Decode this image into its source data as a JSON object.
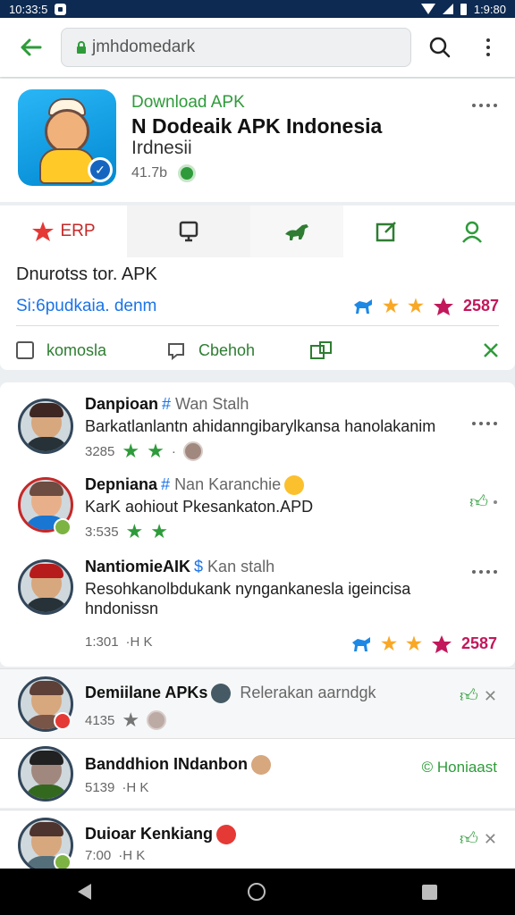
{
  "status": {
    "time": "10:33:5",
    "right_text": "1:9:80"
  },
  "url": {
    "text": "jmhdomedark"
  },
  "app": {
    "download_label": "Download APK",
    "title": "N Dodeaik APK Indonesia",
    "subtitle": "Irdnesii",
    "size": "41.7b"
  },
  "tabs": {
    "erp_label": "ERP"
  },
  "description": {
    "title": "Dnurotss tor. APK",
    "link": "Si:6pudkaia. denm",
    "rating_count": "2587"
  },
  "actions": {
    "first_label": "komosla",
    "second_label": "Cbehoh"
  },
  "reviews": [
    {
      "name": "Danpioan",
      "handle": "Wan Stalh",
      "text": "Barkatlanlantn ahidanngibarylkansa hanolakanim",
      "count": "3285"
    },
    {
      "name": "Depniana",
      "handle": "Nan  Karanchie",
      "text": "KarK aohiout  Pkesankaton.APD",
      "count": "3:535"
    },
    {
      "name": "NantiomieAIK",
      "handle": "Kan stalh",
      "text": "Resohkanolbdukank  nyngankanesla igeincisa hndonissn",
      "count": "1:301",
      "meta_suffix": "·H K",
      "rating_count": "2587"
    }
  ],
  "list": [
    {
      "name": "Demiilane APKs",
      "tag": "Relerakan aarndgk",
      "count": "4135"
    },
    {
      "name": "Banddhion INdanbon",
      "side_label": "© Honiaast",
      "count": "5139",
      "meta_suffix": "·H K"
    },
    {
      "name": "Duioar Kenkiang",
      "count": "7:00",
      "meta_suffix": "·H K"
    }
  ],
  "colors": {
    "accent": "#2e9b3a",
    "link": "#1a73e8",
    "statusbar": "#0d2a52",
    "badge_pink": "#c2185b"
  }
}
